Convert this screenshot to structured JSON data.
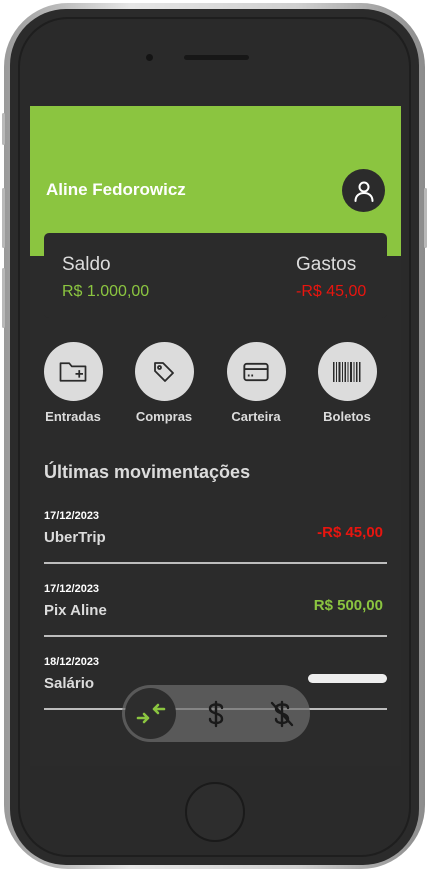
{
  "user": {
    "name": "Aline Fedorowicz",
    "avatar_icon": "user-icon"
  },
  "balance": {
    "saldo_label": "Saldo",
    "saldo_value": "R$ 1.000,00",
    "gastos_label": "Gastos",
    "gastos_value": "-R$ 45,00"
  },
  "actions": [
    {
      "label": "Entradas",
      "icon": "folder-plus-icon"
    },
    {
      "label": "Compras",
      "icon": "tag-icon"
    },
    {
      "label": "Carteira",
      "icon": "credit-card-icon"
    },
    {
      "label": "Boletos",
      "icon": "barcode-icon"
    }
  ],
  "transactions_title": "Últimas movimentações",
  "transactions": [
    {
      "date": "17/12/2023",
      "name": "UberTrip",
      "amount": "-R$ 45,00",
      "type": "expense"
    },
    {
      "date": "17/12/2023",
      "name": "Pix Aline",
      "amount": "R$ 500,00",
      "type": "income"
    },
    {
      "date": "18/12/2023",
      "name": "Salário",
      "amount": "",
      "type": "loading"
    }
  ],
  "bottom_nav": [
    {
      "icon": "transfer-arrows-icon",
      "active": true
    },
    {
      "icon": "dollar-icon",
      "active": false
    },
    {
      "icon": "dollar-off-icon",
      "active": false
    }
  ],
  "colors": {
    "brand_green": "#8bc540",
    "expense_red": "#e8150f",
    "income_green": "#8bc540",
    "background_dark": "#2b2b2b"
  }
}
